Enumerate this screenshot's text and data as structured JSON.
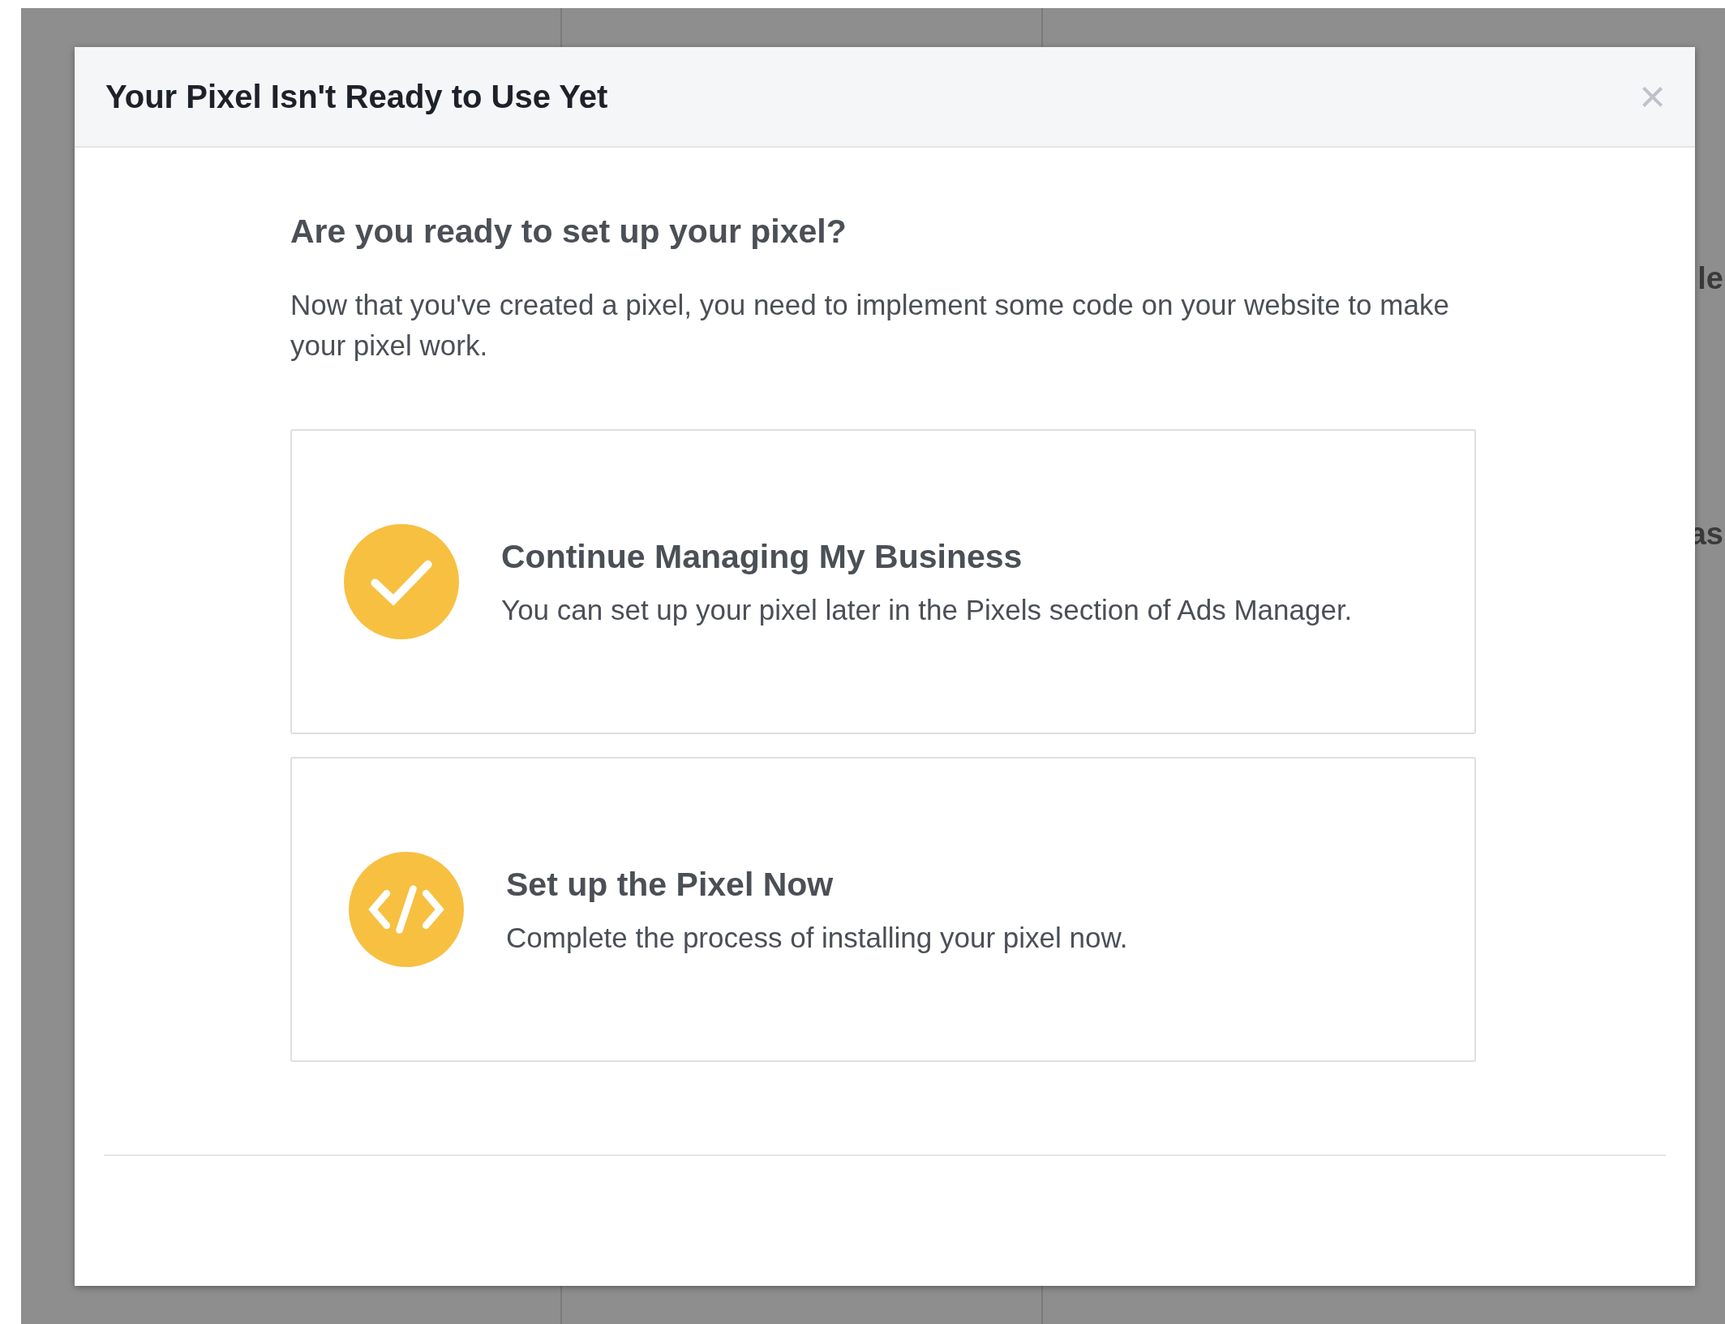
{
  "background": {
    "fragments": [
      "le",
      "as"
    ]
  },
  "dialog": {
    "title": "Your Pixel Isn't Ready to Use Yet",
    "close": "×",
    "heading": "Are you ready to set up your pixel?",
    "intro": "Now that you've created a pixel, you need to implement some code on your website to make your pixel work.",
    "options": [
      {
        "kind": "check",
        "title": "Continue Managing My Business",
        "description": "You can set up your pixel later in the Pixels section of Ads Manager."
      },
      {
        "kind": "code",
        "title": "Set up the Pixel Now",
        "description": "Complete the process of installing your pixel now."
      }
    ]
  }
}
